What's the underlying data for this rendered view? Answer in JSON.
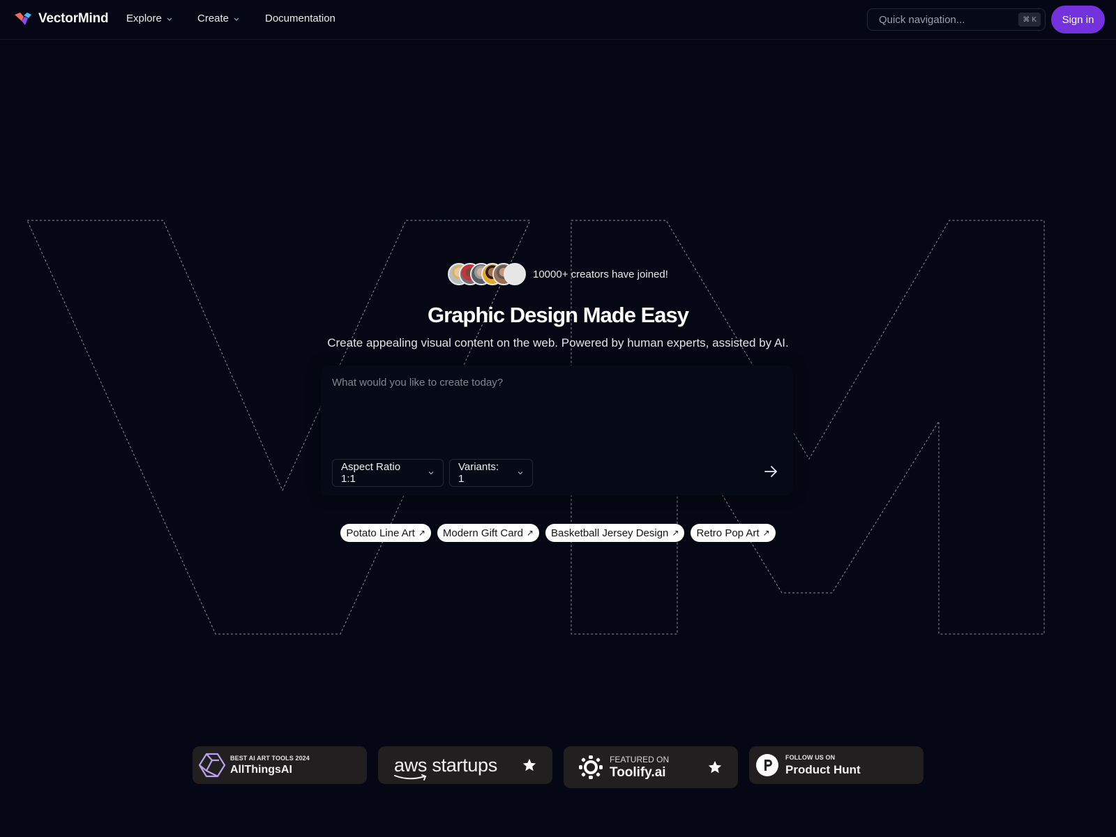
{
  "header": {
    "brand": "VectorMind",
    "nav": [
      {
        "label": "Explore",
        "has_dropdown": true
      },
      {
        "label": "Create",
        "has_dropdown": true
      },
      {
        "label": "Documentation",
        "has_dropdown": false
      }
    ],
    "search": {
      "placeholder": "Quick navigation...",
      "value": "",
      "shortcut_symbol": "⌘",
      "shortcut_key": "K"
    },
    "signin_label": "Sign in",
    "accent_color": "#7432dd"
  },
  "hero": {
    "social_proof": "10000+ creators have joined!",
    "avatar_count": 6,
    "title": "Graphic Design Made Easy",
    "subtitle": "Create appealing visual content on the web. Powered by human experts, assisted by AI.",
    "prompt": {
      "placeholder": "What would you like to create today?",
      "value": "",
      "aspect_ratio_label": "Aspect Ratio 1:1",
      "variants_label": "Variants: 1",
      "submit_icon": "arrow-right-icon"
    },
    "suggestions": [
      {
        "label": "Potato Line Art",
        "icon": "↗"
      },
      {
        "label": "Modern Gift Card",
        "icon": "↗"
      },
      {
        "label": "Basketball Jersey Design",
        "icon": "↗"
      },
      {
        "label": "Retro Pop Art",
        "icon": "↗"
      }
    ],
    "background_monogram": "VM"
  },
  "badges": [
    {
      "small": "BEST AI ART TOOLS 2024",
      "big": "AllThingsAI",
      "icon": "cube-icon"
    },
    {
      "small": "",
      "big": "aws startups",
      "icon": "star-icon"
    },
    {
      "small": "FEATURED ON",
      "big": "Toolify.ai",
      "icon": "star-icon"
    },
    {
      "small": "FOLLOW US ON",
      "big": "Product Hunt",
      "icon": "product-hunt-icon"
    }
  ]
}
